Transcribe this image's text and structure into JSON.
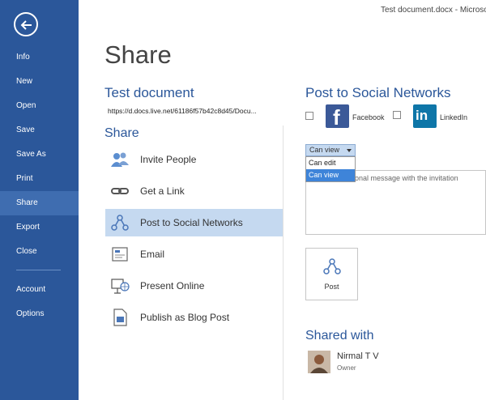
{
  "window": {
    "title": "Test document.docx - Microsof"
  },
  "nav": {
    "items": [
      {
        "label": "Info"
      },
      {
        "label": "New"
      },
      {
        "label": "Open"
      },
      {
        "label": "Save"
      },
      {
        "label": "Save As"
      },
      {
        "label": "Print"
      },
      {
        "label": "Share",
        "active": true
      },
      {
        "label": "Export"
      },
      {
        "label": "Close"
      },
      {
        "label": "Account"
      },
      {
        "label": "Options"
      }
    ],
    "color": "#2b579a"
  },
  "page": {
    "heading": "Share",
    "document_name": "Test document",
    "document_url": "https://d.docs.live.net/61186f57b42c8d45/Docu...",
    "share_heading": "Share"
  },
  "share_options": [
    {
      "label": "Invite People",
      "icon": "people-icon"
    },
    {
      "label": "Get a Link",
      "icon": "link-icon"
    },
    {
      "label": "Post to Social Networks",
      "icon": "social-network-icon",
      "selected": true
    },
    {
      "label": "Email",
      "icon": "email-icon"
    },
    {
      "label": "Present Online",
      "icon": "present-online-icon"
    },
    {
      "label": "Publish as Blog Post",
      "icon": "blog-post-icon"
    }
  ],
  "social": {
    "title": "Post to Social Networks",
    "networks": [
      {
        "label": "Facebook",
        "logo_text": "f",
        "checked": false
      },
      {
        "label": "LinkedIn",
        "logo_text": "in",
        "checked": false
      }
    ],
    "permission": {
      "value": "Can view",
      "options": [
        "Can edit",
        "Can view"
      ],
      "highlighted": "Can view"
    },
    "message_placeholder": "onal message with the invitation",
    "post_button": "Post"
  },
  "shared_with": {
    "title": "Shared with",
    "users": [
      {
        "name": "Nirmal T V",
        "role": "Owner"
      }
    ]
  }
}
